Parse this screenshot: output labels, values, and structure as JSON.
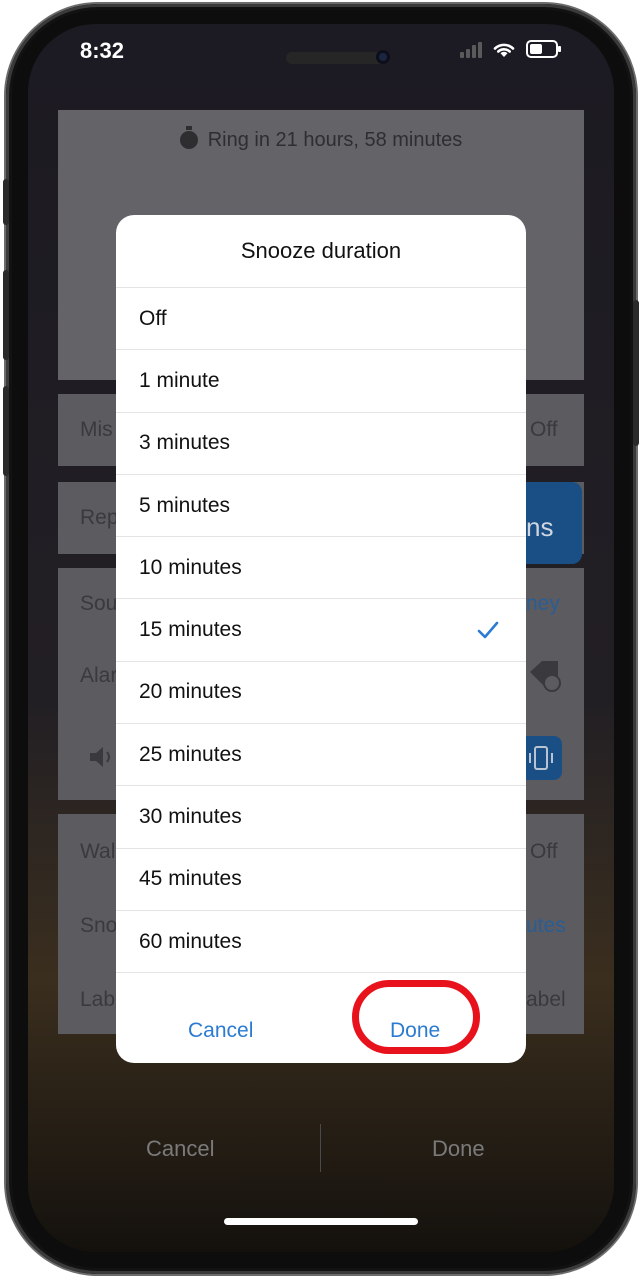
{
  "status_bar": {
    "time": "8:32"
  },
  "background_app": {
    "ring_text": "Ring in 21 hours, 58 minutes",
    "rows": [
      {
        "label": "Mis",
        "value": "Off"
      },
      {
        "label": "Rep",
        "value": "ns"
      },
      {
        "label": "Sou",
        "value": "ney"
      },
      {
        "label": "Alar",
        "value": ""
      },
      {
        "label": "Wal",
        "value": "Off"
      },
      {
        "label": "Sno",
        "value": "utes"
      },
      {
        "label": "Lab",
        "value": "abel"
      }
    ],
    "bottom_cancel": "Cancel",
    "bottom_done": "Done"
  },
  "dialog": {
    "title": "Snooze duration",
    "options": [
      {
        "label": "Off",
        "selected": false
      },
      {
        "label": "1 minute",
        "selected": false
      },
      {
        "label": "3 minutes",
        "selected": false
      },
      {
        "label": "5 minutes",
        "selected": false
      },
      {
        "label": "10 minutes",
        "selected": false
      },
      {
        "label": "15 minutes",
        "selected": true
      },
      {
        "label": "20 minutes",
        "selected": false
      },
      {
        "label": "25 minutes",
        "selected": false
      },
      {
        "label": "30 minutes",
        "selected": false
      },
      {
        "label": "45 minutes",
        "selected": false
      },
      {
        "label": "60 minutes",
        "selected": false
      }
    ],
    "cancel_label": "Cancel",
    "done_label": "Done"
  },
  "colors": {
    "accent": "#2a7bd1",
    "highlight": "#e8121d"
  }
}
